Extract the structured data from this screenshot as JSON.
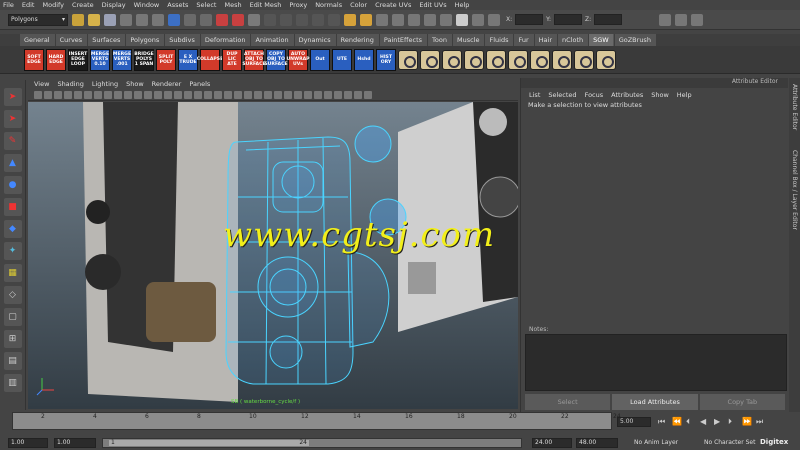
{
  "menubar": [
    "File",
    "Edit",
    "Modify",
    "Create",
    "Display",
    "Window",
    "Assets",
    "Select",
    "Mesh",
    "Edit Mesh",
    "Proxy",
    "Normals",
    "Color",
    "Create UVs",
    "Edit UVs",
    "Help"
  ],
  "status": {
    "mode": "Polygons",
    "x_label": "X:",
    "y_label": "Y:",
    "z_label": "Z:"
  },
  "shelf_tabs": [
    "General",
    "Curves",
    "Surfaces",
    "Polygons",
    "Subdivs",
    "Deformation",
    "Animation",
    "Dynamics",
    "Rendering",
    "PaintEffects",
    "Toon",
    "Muscle",
    "Fluids",
    "Fur",
    "Hair",
    "nCloth",
    "SGW",
    "GoZBrush"
  ],
  "shelf_active": "SGW",
  "shelf_buttons": [
    {
      "label": "SOFT EDGE",
      "color": "#d23a2a"
    },
    {
      "label": "HARD EDGE",
      "color": "#d23a2a"
    },
    {
      "label": "INSERT EDGE LOOP",
      "color": "#1a1a1a"
    },
    {
      "label": "MERGE VERTS 0.10",
      "color": "#2a5fbf"
    },
    {
      "label": "MERGE VERTS .001",
      "color": "#2a5fbf"
    },
    {
      "label": "BRIDGE POLYS 1 SPAN",
      "color": "#1a1a1a"
    },
    {
      "label": "SPLIT POLY",
      "color": "#d23a2a"
    },
    {
      "label": "E X TRUDE",
      "color": "#2a5fbf"
    },
    {
      "label": "COLLAPSE",
      "color": "#d23a2a"
    },
    {
      "label": "DUP LIC ATE",
      "color": "#d23a2a"
    },
    {
      "label": "ATTACH OBJ TO SURFACE",
      "color": "#d23a2a"
    },
    {
      "label": "COPY OBJ TO SURFACE",
      "color": "#2a5fbf"
    },
    {
      "label": "AUTO UNWRAP UVs",
      "color": "#d23a2a"
    },
    {
      "label": "Out",
      "color": "#2a5fbf"
    },
    {
      "label": "UTE",
      "color": "#2a5fbf"
    },
    {
      "label": "Hshd",
      "color": "#2a5fbf"
    },
    {
      "label": "HIST ORY",
      "color": "#2a5fbf"
    }
  ],
  "viewport": {
    "menu": [
      "View",
      "Shading",
      "Lighting",
      "Show",
      "Renderer",
      "Panels"
    ],
    "watermark": "www.cgtsj.com",
    "camera": "SB ( waterborne_cycle/f )"
  },
  "attribute_editor": {
    "title": "Attribute Editor",
    "menu": [
      "List",
      "Selected",
      "Focus",
      "Attributes",
      "Show",
      "Help"
    ],
    "message": "Make a selection to view attributes",
    "notes_label": "Notes:",
    "buttons": [
      "Select",
      "Load Attributes",
      "Copy Tab"
    ]
  },
  "side_tabs": [
    "Attribute Editor",
    "Channel Box / Layer Editor"
  ],
  "timeline": {
    "ticks": [
      "2",
      "4",
      "6",
      "8",
      "10",
      "12",
      "14",
      "16",
      "18",
      "20",
      "22",
      "24"
    ],
    "current": "5.00"
  },
  "range": {
    "start": "1.00",
    "playback_start": "1.00",
    "thumb_start": "1",
    "thumb_end": "24",
    "playback_end": "24.00",
    "end": "48.00",
    "anim_layer": "No Anim Layer",
    "character": "No Character Set",
    "logo": "Digitex"
  }
}
